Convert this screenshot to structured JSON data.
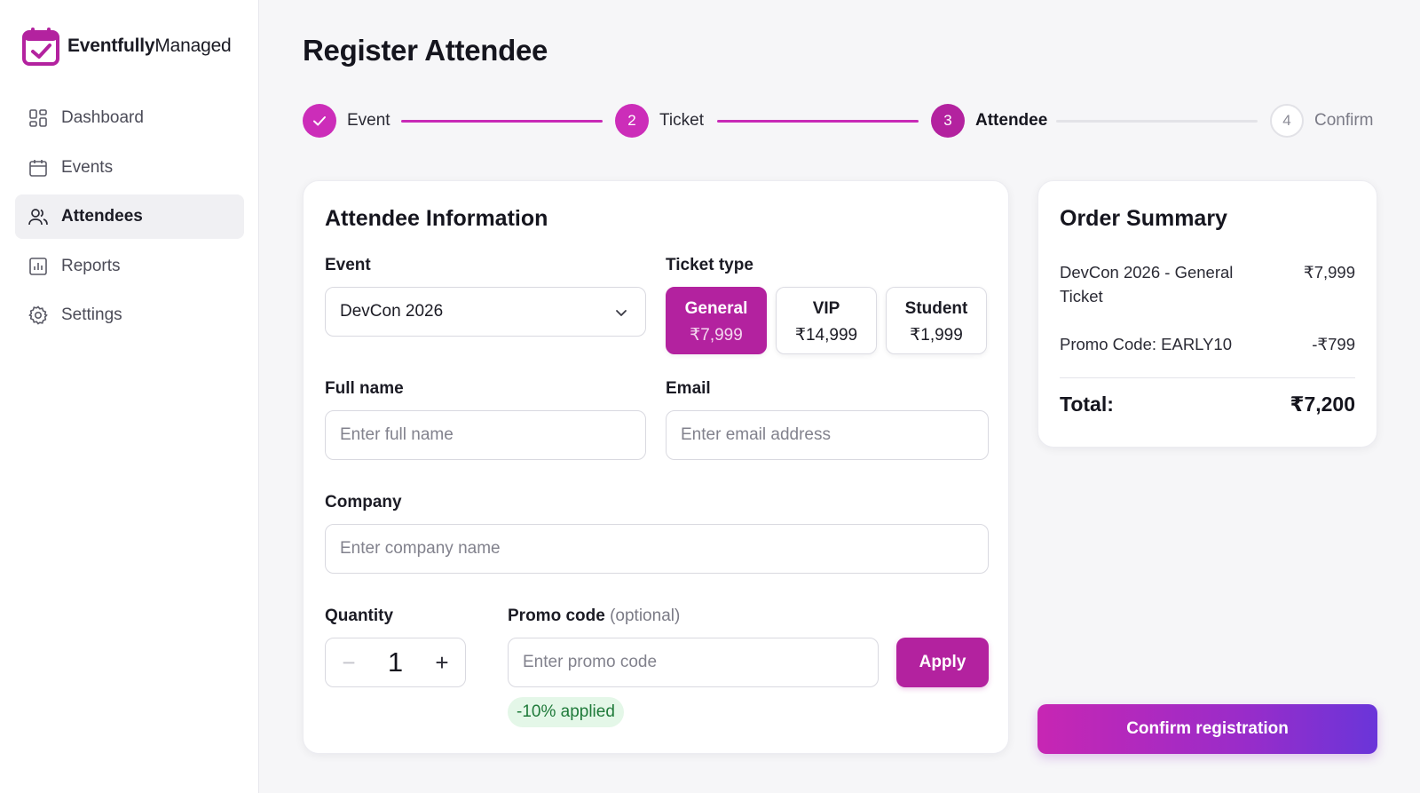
{
  "brand": {
    "name_bold": "Eventfully",
    "name_regular": "Managed",
    "logo_icon": "calendar-check-icon",
    "accent": "#b3229f"
  },
  "sidebar": {
    "items": [
      {
        "label": "Dashboard",
        "icon": "dashboard-grid-icon",
        "active": false
      },
      {
        "label": "Events",
        "icon": "calendar-icon",
        "active": false
      },
      {
        "label": "Attendees",
        "icon": "users-icon",
        "active": true
      },
      {
        "label": "Reports",
        "icon": "bar-chart-icon",
        "active": false
      },
      {
        "label": "Settings",
        "icon": "gear-icon",
        "active": false
      }
    ]
  },
  "page": {
    "title": "Register Attendee"
  },
  "stepper": {
    "steps": [
      {
        "number": "1",
        "label": "Event",
        "state": "done"
      },
      {
        "number": "2",
        "label": "Ticket",
        "state": "done"
      },
      {
        "number": "3",
        "label": "Attendee",
        "state": "current"
      },
      {
        "number": "4",
        "label": "Confirm",
        "state": "todo"
      }
    ]
  },
  "form": {
    "title": "Attendee Information",
    "event": {
      "label": "Event",
      "value": "DevCon 2026"
    },
    "ticket_type": {
      "label": "Ticket type",
      "options": [
        {
          "name": "General",
          "price": "₹7,999",
          "selected": true
        },
        {
          "name": "VIP",
          "price": "₹14,999",
          "selected": false
        },
        {
          "name": "Student",
          "price": "₹1,999",
          "selected": false
        }
      ]
    },
    "full_name": {
      "label": "Full name",
      "placeholder": "Enter full name"
    },
    "email": {
      "label": "Email",
      "placeholder": "Enter email address"
    },
    "company": {
      "label": "Company",
      "placeholder": "Enter company name"
    },
    "quantity": {
      "label": "Quantity",
      "value": "1",
      "minus": "−",
      "plus": "+"
    },
    "promo": {
      "label": "Promo code",
      "label_hint": "(optional)",
      "placeholder": "Enter promo code",
      "apply_label": "Apply",
      "status": "-10% applied"
    }
  },
  "summary": {
    "title": "Order Summary",
    "lines": [
      {
        "label": "DevCon 2026 - General Ticket",
        "amount": "₹7,999"
      },
      {
        "label": "Promo Code: EARLY10",
        "amount": "-₹799"
      }
    ],
    "total_label": "Total:",
    "total_amount": "₹7,200"
  },
  "actions": {
    "confirm_label": "Confirm registration"
  }
}
